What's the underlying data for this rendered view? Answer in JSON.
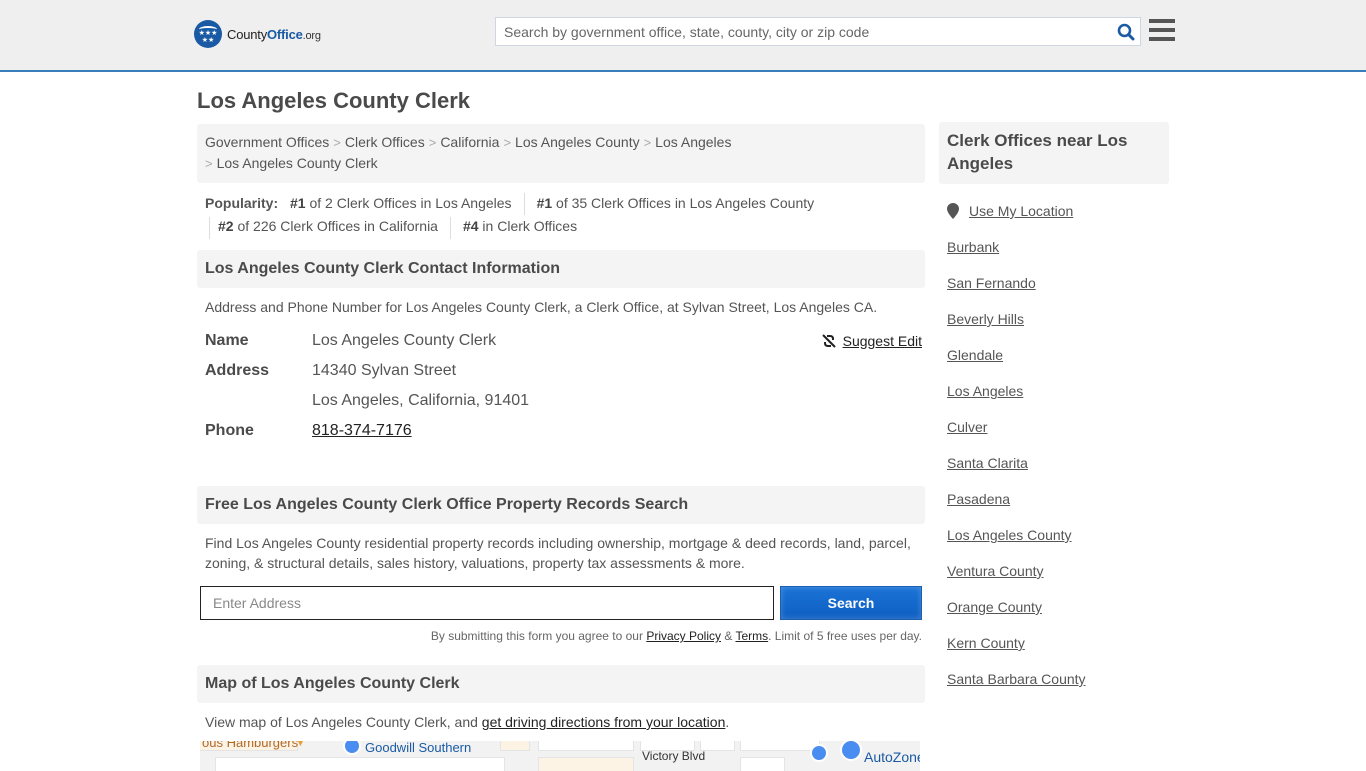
{
  "header": {
    "logo": {
      "part1": "County",
      "part2": "Office",
      "part3": ".org"
    },
    "search": {
      "placeholder": "Search by government office, state, county, city or zip code",
      "value": ""
    },
    "search_icon": "search-icon",
    "menu_icon": "hamburger-menu-icon"
  },
  "page": {
    "title": "Los Angeles County Clerk"
  },
  "breadcrumb": [
    "Government Offices",
    "Clerk Offices",
    "California",
    "Los Angeles County",
    "Los Angeles",
    "Los Angeles County Clerk"
  ],
  "popularity": {
    "label": "Popularity:",
    "items": [
      {
        "rank": "#1",
        "text": " of 2 Clerk Offices in Los Angeles"
      },
      {
        "rank": "#1",
        "text": " of 35 Clerk Offices in Los Angeles County"
      },
      {
        "rank": "#2",
        "text": " of 226 Clerk Offices in California"
      },
      {
        "rank": "#4",
        "text": " in Clerk Offices"
      }
    ]
  },
  "contact": {
    "heading": "Los Angeles County Clerk Contact Information",
    "description": "Address and Phone Number for Los Angeles County Clerk, a Clerk Office, at Sylvan Street, Los Angeles CA.",
    "suggest_edit": "Suggest Edit",
    "fields": {
      "name_label": "Name",
      "name_value": "Los Angeles County Clerk",
      "address_label": "Address",
      "address_line1": "14340 Sylvan Street",
      "address_line2": "Los Angeles, California, 91401",
      "phone_label": "Phone",
      "phone_value": "818-374-7176"
    }
  },
  "property": {
    "heading": "Free Los Angeles County Clerk Office Property Records Search",
    "description": "Find Los Angeles County residential property records including ownership, mortgage & deed records, land, parcel, zoning, & structural details, sales history, valuations, property tax assessments & more.",
    "input_placeholder": "Enter Address",
    "input_value": "",
    "button": "Search",
    "terms_prefix": "By submitting this form you agree to our ",
    "privacy": "Privacy Policy",
    "amp": " & ",
    "terms": "Terms",
    "terms_suffix": ". Limit of 5 free uses per day."
  },
  "map": {
    "heading": "Map of Los Angeles County Clerk",
    "desc_prefix": "View map of Los Angeles County Clerk, and ",
    "desc_link": "get driving directions from your location",
    "desc_suffix": ".",
    "labels": {
      "burgers": "ous Hamburgers",
      "goodwill": "Goodwill Southern",
      "street": "Victory Blvd",
      "autozone": "AutoZone"
    }
  },
  "sidebar": {
    "heading": "Clerk Offices near Los Angeles",
    "use_location": "Use My Location",
    "links": [
      "Burbank",
      "San Fernando",
      "Beverly Hills",
      "Glendale",
      "Los Angeles",
      "Culver",
      "Santa Clarita",
      "Pasadena",
      "Los Angeles County",
      "Ventura County",
      "Orange County",
      "Kern County",
      "Santa Barbara County"
    ]
  },
  "colors": {
    "accent": "#3a7dbc",
    "brand": "#1a5aa5",
    "button": "#1a6fd0"
  }
}
